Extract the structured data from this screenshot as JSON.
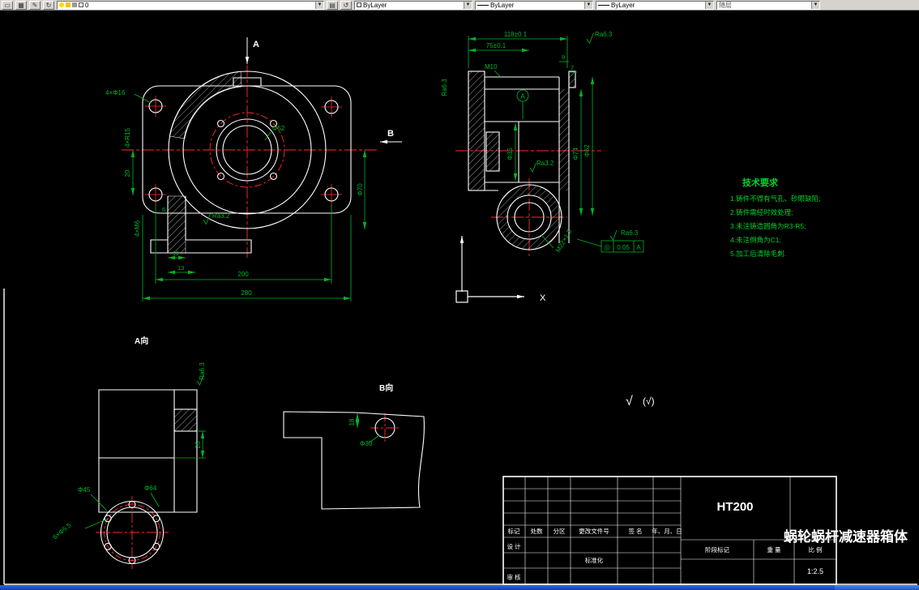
{
  "colors": {
    "background": "#000000",
    "geometry": "#ffffff",
    "centerline": "#ff2a2a",
    "dimension": "#00b428",
    "annotation": "#00d22d",
    "toolbar_bg": "#d6d3ce",
    "taskbar": "#2a62e8"
  },
  "toolbar": {
    "layer_value": "0",
    "color_value": "ByLayer",
    "linetype_value": "ByLayer",
    "lineweight_value": "ByLayer",
    "plotstyle_value": "随层"
  },
  "views": {
    "front": {
      "arrow_a": "A",
      "arrow_b": "B",
      "dim_4xd16": "4×Φ16",
      "dim_4xr15": "4×R15",
      "dim_20": "20",
      "dim_4xm6": "4×M6",
      "dim_ra32": "Ra3.2",
      "dim_d52": "Φ52",
      "dim_6": "6",
      "dim_11": "11",
      "dim_13": "13",
      "dim_200": "200",
      "dim_280": "280",
      "dim_d70": "Φ70"
    },
    "section": {
      "dim_118": "118±0.1",
      "dim_75": "75±0.1",
      "dim_m10": "M10",
      "dim_9": "9",
      "dim_7": "7",
      "dim_ra63_top": "Ra6.3",
      "dim_ra63_left": "Ra6.3",
      "datum_label": "A",
      "dim_d35": "Φ35",
      "dim_ra32": "Ra3.2",
      "dim_d74": "Φ74",
      "dim_d62": "Φ62",
      "dim_m22": "M22×1.5",
      "dim_ra63_right": "Ra6.3",
      "tol_symbol": "◎",
      "tol_value": "0.05",
      "tol_datum": "A"
    },
    "tech_req": {
      "title": "技术要求",
      "lines": [
        "1.铸件不得有气孔、砂眼缺陷;",
        "2.铸件需经时效处理;",
        "3.未注铸造圆角为R3-R5;",
        "4.未注倒角为C1;",
        "5.加工后清除毛刺."
      ]
    },
    "ucs": {
      "x_label": "X"
    },
    "finish": {
      "primary": "√",
      "secondary": "(√)"
    },
    "view_a": {
      "label": "A向",
      "dim_ra63": "Ra6.3",
      "dim_26": "26",
      "dim_d45": "Φ45",
      "dim_d64": "Φ64",
      "dim_6xd55": "6×Φ5.5"
    },
    "view_b": {
      "label": "B向",
      "dim_18": "18",
      "dim_d30": "Φ30"
    }
  },
  "titleblock": {
    "material": "HT200",
    "part_name": "蜗轮蜗杆减速器箱体",
    "headers": [
      "标记",
      "处数",
      "分区",
      "更改文件号",
      "签 名",
      "年、月、日"
    ],
    "row_design": "设 计",
    "row_standard": "标准化",
    "row_check": "审 核",
    "stage_label": "阶段标记",
    "weight_label": "重 量",
    "scale_label": "比 例",
    "scale_value": "1:2.5"
  }
}
